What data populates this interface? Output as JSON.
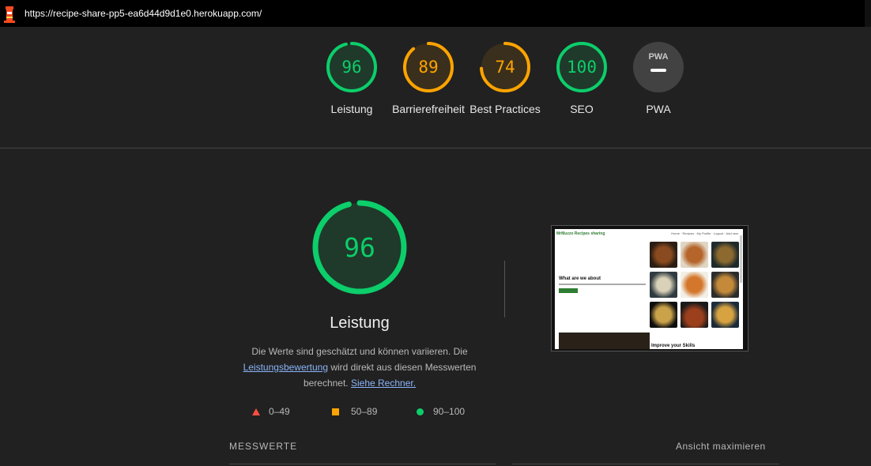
{
  "browser": {
    "url": "https://recipe-share-pp5-ea6d44d9d1e0.herokuapp.com/"
  },
  "scores": [
    {
      "value": "96",
      "label": "Leistung",
      "status": "pass",
      "fraction": 0.96
    },
    {
      "value": "89",
      "label": "Barrierefreiheit",
      "status": "average",
      "fraction": 0.89
    },
    {
      "value": "74",
      "label": "Best Practices",
      "status": "average",
      "fraction": 0.74
    },
    {
      "value": "100",
      "label": "SEO",
      "status": "pass",
      "fraction": 1.0
    },
    {
      "value": "PWA",
      "label": "PWA",
      "status": "na",
      "fraction": 0
    }
  ],
  "performance": {
    "score": "96",
    "fraction": 0.96,
    "title": "Leistung",
    "desc_part1": "Die Werte sind geschätzt und können variieren. Die ",
    "desc_link1": "Leistungsbewertung",
    "desc_part2": " wird direkt aus diesen Messwerten berechnet. ",
    "desc_link2": "Siehe Rechner."
  },
  "legend": {
    "fail": "0–49",
    "average": "50–89",
    "pass": "90–100"
  },
  "screenshot": {
    "brand": "MrMuzzo Recipes sharing",
    "nav_items": "Home · Recipes · My Profile · Logout · Add new",
    "hero_title": "What are we about",
    "skills_title": "Improve your Skills"
  },
  "sections": {
    "metrics": "MESSWERTE",
    "expand": "Ansicht maximieren"
  },
  "colors": {
    "pass": "#0cce6b",
    "average": "#ffa400",
    "fail": "#ff4e42",
    "na": "#9e9e9e"
  }
}
